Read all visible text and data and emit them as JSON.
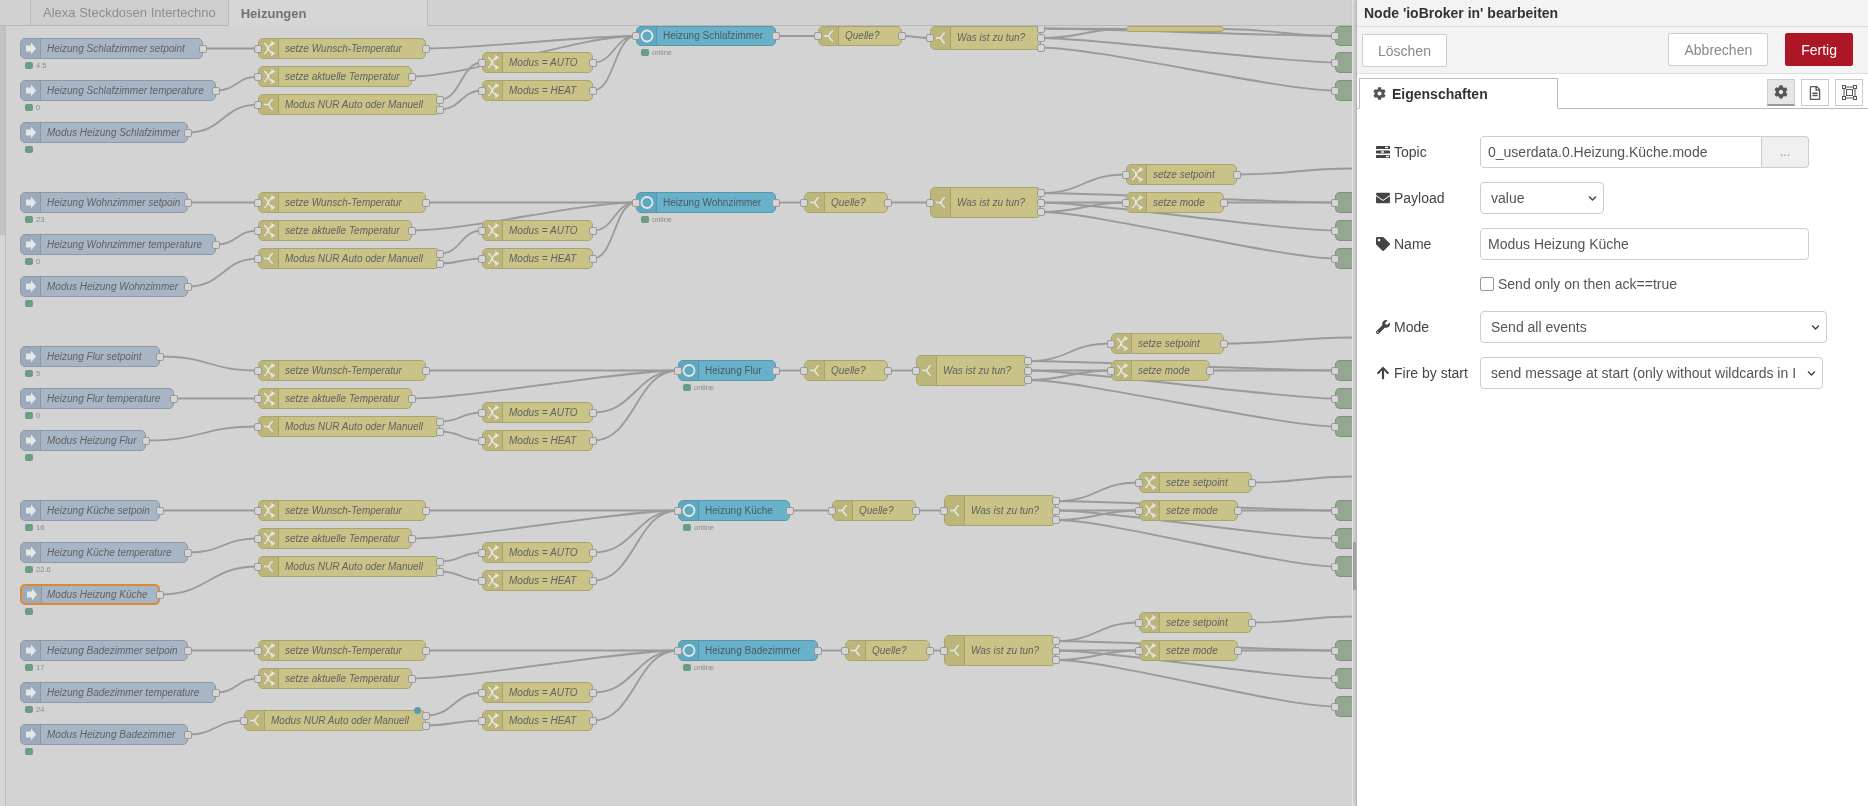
{
  "tabs": [
    {
      "label": "Alexa Steckdosen Intertechno",
      "selected": false
    },
    {
      "label": "Heizungen",
      "selected": true
    }
  ],
  "flows": [
    {
      "nodes": [
        {
          "kind": "input",
          "label": "Heizung Schlafzimmer setpoint",
          "status_text": "4.5",
          "status_dot": true,
          "selected": false,
          "changed": false
        },
        {
          "kind": "input",
          "label": "Heizung Schlafzimmer temperature",
          "status_text": "0",
          "status_dot": true,
          "selected": false,
          "changed": false
        },
        {
          "kind": "input",
          "label": "Modus Heizung Schlafzimmer",
          "status_dot": true,
          "selected": false,
          "changed": false
        },
        {
          "kind": "change",
          "label": "setze Wunsch-Temperatur",
          "status_dot": false,
          "selected": false,
          "changed": false
        },
        {
          "kind": "change",
          "label": "setze aktuelle Temperatur",
          "status_dot": false,
          "selected": false,
          "changed": false
        },
        {
          "kind": "switch",
          "label": "Modus NUR Auto oder Manuell",
          "status_dot": false,
          "selected": false,
          "changed": false
        },
        {
          "kind": "change",
          "label": "Modus = AUTO",
          "status_dot": false,
          "selected": false,
          "changed": false
        },
        {
          "kind": "change",
          "label": "Modus = HEAT",
          "status_dot": false,
          "selected": false,
          "changed": false
        },
        {
          "kind": "device",
          "label": "Heizung Schlafzimmer",
          "status_text": "online",
          "status_dot": true,
          "selected": false,
          "changed": false
        },
        {
          "kind": "switch",
          "label": "Quelle?",
          "status_dot": false,
          "selected": false,
          "changed": false
        },
        {
          "kind": "switch",
          "label": "Was ist zu tun?",
          "status_dot": false,
          "selected": false,
          "changed": false
        },
        {
          "kind": "change",
          "status_dot": false,
          "selected": false,
          "changed": false
        },
        {
          "kind": "output",
          "status_dot": false,
          "selected": false,
          "changed": false
        },
        {
          "kind": "output",
          "status_dot": false,
          "selected": false,
          "changed": false
        },
        {
          "kind": "output",
          "status_dot": false,
          "selected": false,
          "changed": false
        }
      ]
    },
    {
      "nodes": [
        {
          "kind": "input",
          "label": "Heizung Wohnzimmer setpoin",
          "status_text": "23",
          "status_dot": true,
          "selected": false,
          "changed": false
        },
        {
          "kind": "input",
          "label": "Heizung Wohnzimmer temperature",
          "status_text": "0",
          "status_dot": true,
          "selected": false,
          "changed": false
        },
        {
          "kind": "input",
          "label": "Modus Heizung Wohnzimmer",
          "status_dot": true,
          "selected": false,
          "changed": false
        },
        {
          "kind": "change",
          "label": "setze Wunsch-Temperatur",
          "status_dot": false,
          "selected": false,
          "changed": false
        },
        {
          "kind": "change",
          "label": "setze aktuelle Temperatur",
          "status_dot": false,
          "selected": false,
          "changed": false
        },
        {
          "kind": "switch",
          "label": "Modus NUR Auto oder Manuell",
          "status_dot": false,
          "selected": false,
          "changed": false
        },
        {
          "kind": "change",
          "label": "Modus = AUTO",
          "status_dot": false,
          "selected": false,
          "changed": false
        },
        {
          "kind": "change",
          "label": "Modus = HEAT",
          "status_dot": false,
          "selected": false,
          "changed": false
        },
        {
          "kind": "device",
          "label": "Heizung Wohnzimmer",
          "status_text": "online",
          "status_dot": true,
          "selected": false,
          "changed": false
        },
        {
          "kind": "switch",
          "label": "Quelle?",
          "status_dot": false,
          "selected": false,
          "changed": false
        },
        {
          "kind": "switch",
          "label": "Was ist zu tun?",
          "status_dot": false,
          "selected": false,
          "changed": false
        },
        {
          "kind": "change",
          "label": "setze setpoint",
          "status_dot": false,
          "selected": false,
          "changed": false
        },
        {
          "kind": "change",
          "label": "setze mode",
          "status_dot": false,
          "selected": false,
          "changed": false
        },
        {
          "kind": "output",
          "status_dot": false,
          "selected": false,
          "changed": false
        },
        {
          "kind": "output",
          "status_dot": false,
          "selected": false,
          "changed": false
        },
        {
          "kind": "output",
          "status_dot": false,
          "selected": false,
          "changed": false
        }
      ]
    },
    {
      "nodes": [
        {
          "kind": "input",
          "label": "Heizung Flur setpoint",
          "status_text": "5",
          "status_dot": true,
          "selected": false,
          "changed": false
        },
        {
          "kind": "input",
          "label": "Heizung Flur temperature",
          "status_text": "0",
          "status_dot": true,
          "selected": false,
          "changed": false
        },
        {
          "kind": "input",
          "label": "Modus Heizung Flur",
          "status_dot": true,
          "selected": false,
          "changed": false
        },
        {
          "kind": "change",
          "label": "setze Wunsch-Temperatur",
          "status_dot": false,
          "selected": false,
          "changed": false
        },
        {
          "kind": "change",
          "label": "setze aktuelle Temperatur",
          "status_dot": false,
          "selected": false,
          "changed": false
        },
        {
          "kind": "switch",
          "label": "Modus NUR Auto oder Manuell",
          "status_dot": false,
          "selected": false,
          "changed": false
        },
        {
          "kind": "change",
          "label": "Modus = AUTO",
          "status_dot": false,
          "selected": false,
          "changed": false
        },
        {
          "kind": "change",
          "label": "Modus = HEAT",
          "status_dot": false,
          "selected": false,
          "changed": false
        },
        {
          "kind": "device",
          "label": "Heizung Flur",
          "status_text": "online",
          "status_dot": true,
          "selected": false,
          "changed": false
        },
        {
          "kind": "switch",
          "label": "Quelle?",
          "status_dot": false,
          "selected": false,
          "changed": false
        },
        {
          "kind": "switch",
          "label": "Was ist zu tun?",
          "status_dot": false,
          "selected": false,
          "changed": false
        },
        {
          "kind": "change",
          "label": "setze setpoint",
          "status_dot": false,
          "selected": false,
          "changed": false
        },
        {
          "kind": "change",
          "label": "setze mode",
          "status_dot": false,
          "selected": false,
          "changed": false
        },
        {
          "kind": "output",
          "status_dot": false,
          "selected": false,
          "changed": false
        },
        {
          "kind": "output",
          "status_dot": false,
          "selected": false,
          "changed": false
        },
        {
          "kind": "output",
          "status_dot": false,
          "selected": false,
          "changed": false
        }
      ]
    },
    {
      "nodes": [
        {
          "kind": "input",
          "label": "Heizung Küche setpoin",
          "status_text": "16",
          "status_dot": true,
          "selected": false,
          "changed": false
        },
        {
          "kind": "input",
          "label": "Heizung Küche temperature",
          "status_text": "22.6",
          "status_dot": true,
          "selected": false,
          "changed": false
        },
        {
          "kind": "input",
          "label": "Modus Heizung Küche",
          "status_dot": true,
          "selected": true,
          "changed": false
        },
        {
          "kind": "change",
          "label": "setze Wunsch-Temperatur",
          "status_dot": false,
          "selected": false,
          "changed": false
        },
        {
          "kind": "change",
          "label": "setze aktuelle Temperatur",
          "status_dot": false,
          "selected": false,
          "changed": false
        },
        {
          "kind": "switch",
          "label": "Modus NUR Auto oder Manuell",
          "status_dot": false,
          "selected": false,
          "changed": false
        },
        {
          "kind": "change",
          "label": "Modus = AUTO",
          "status_dot": false,
          "selected": false,
          "changed": false
        },
        {
          "kind": "change",
          "label": "Modus = HEAT",
          "status_dot": false,
          "selected": false,
          "changed": false
        },
        {
          "kind": "device",
          "label": "Heizung Küche",
          "status_text": "online",
          "status_dot": true,
          "selected": false,
          "changed": false
        },
        {
          "kind": "switch",
          "label": "Quelle?",
          "status_dot": false,
          "selected": false,
          "changed": false
        },
        {
          "kind": "switch",
          "label": "Was ist zu tun?",
          "status_dot": false,
          "selected": false,
          "changed": false
        },
        {
          "kind": "change",
          "label": "setze setpoint",
          "status_dot": false,
          "selected": false,
          "changed": false
        },
        {
          "kind": "change",
          "label": "setze mode",
          "status_dot": false,
          "selected": false,
          "changed": false
        },
        {
          "kind": "output",
          "status_dot": false,
          "selected": false,
          "changed": false
        },
        {
          "kind": "output",
          "status_dot": false,
          "selected": false,
          "changed": false
        },
        {
          "kind": "output",
          "status_dot": false,
          "selected": false,
          "changed": false
        }
      ]
    },
    {
      "nodes": [
        {
          "kind": "input",
          "label": "Heizung Badezimmer setpoin",
          "status_text": "17",
          "status_dot": true,
          "selected": false,
          "changed": false
        },
        {
          "kind": "input",
          "label": "Heizung Badezimmer temperature",
          "status_text": "24",
          "status_dot": true,
          "selected": false,
          "changed": false
        },
        {
          "kind": "input",
          "label": "Modus Heizung Badezimmer",
          "status_dot": true,
          "selected": false,
          "changed": false
        },
        {
          "kind": "change",
          "label": "setze Wunsch-Temperatur",
          "status_dot": false,
          "selected": false,
          "changed": false
        },
        {
          "kind": "change",
          "label": "setze aktuelle Temperatur",
          "status_dot": false,
          "selected": false,
          "changed": false
        },
        {
          "kind": "switch",
          "label": "Modus NUR Auto oder Manuell",
          "status_dot": false,
          "selected": false,
          "changed": true
        },
        {
          "kind": "change",
          "label": "Modus = AUTO",
          "status_dot": false,
          "selected": false,
          "changed": false
        },
        {
          "kind": "change",
          "label": "Modus = HEAT",
          "status_dot": false,
          "selected": false,
          "changed": false
        },
        {
          "kind": "device",
          "label": "Heizung Badezimmer",
          "status_text": "online",
          "status_dot": true,
          "selected": false,
          "changed": false
        },
        {
          "kind": "switch",
          "label": "Quelle?",
          "status_dot": false,
          "selected": false,
          "changed": false
        },
        {
          "kind": "switch",
          "label": "Was ist zu tun?",
          "status_dot": false,
          "selected": false,
          "changed": false
        },
        {
          "kind": "change",
          "label": "setze setpoint",
          "status_dot": false,
          "selected": false,
          "changed": false
        },
        {
          "kind": "change",
          "label": "setze mode",
          "status_dot": false,
          "selected": false,
          "changed": false
        },
        {
          "kind": "output",
          "status_dot": false,
          "selected": false,
          "changed": false
        },
        {
          "kind": "output",
          "status_dot": false,
          "selected": false,
          "changed": false
        },
        {
          "kind": "output",
          "status_dot": false,
          "selected": false,
          "changed": false
        }
      ]
    }
  ],
  "editor": {
    "title": "Node 'ioBroker in' bearbeiten",
    "buttons": [
      {
        "label": "Löschen",
        "kind": "plain"
      },
      {
        "label": "Abbrechen",
        "kind": "plain"
      },
      {
        "label": "Fertig",
        "kind": "primary"
      }
    ],
    "tabs": [
      {
        "label": "Eigenschaften",
        "selected": true
      }
    ],
    "tab_icons": [
      {
        "selected": true
      },
      {
        "selected": false
      },
      {
        "selected": false
      }
    ],
    "fields": [
      {
        "kind": "browse",
        "label": "Topic",
        "value": "0_userdata.0.Heizung.Küche.mode",
        "button": "..."
      },
      {
        "kind": "select",
        "label": "Payload",
        "value": "value"
      },
      {
        "kind": "input",
        "label": "Name",
        "value": "Modus Heizung Küche"
      },
      {
        "kind": "checkbox",
        "label": "Send only on then ack==true",
        "checked": false
      },
      {
        "kind": "select",
        "label": "Mode",
        "value": "Send all events"
      },
      {
        "kind": "select",
        "label": "Fire by start",
        "value": "send message at start (only without wildcards in I"
      }
    ]
  }
}
